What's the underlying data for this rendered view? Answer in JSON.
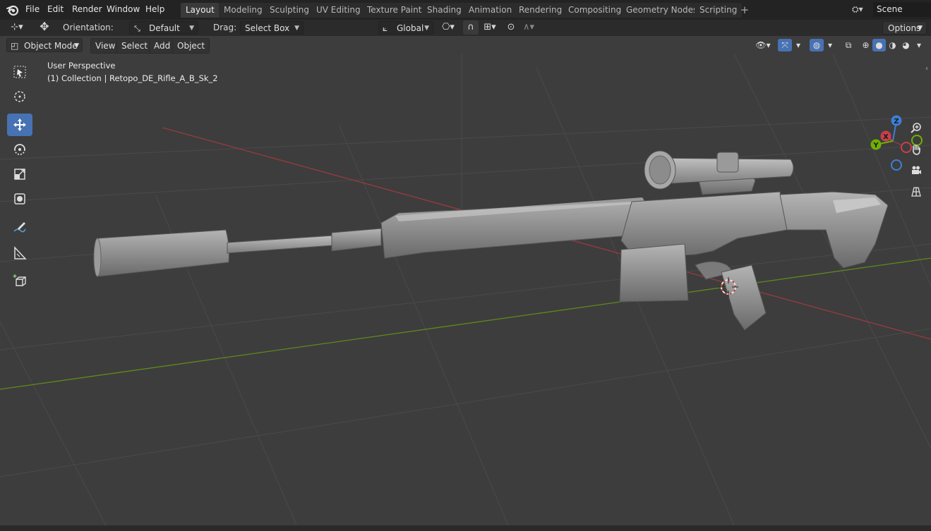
{
  "menu": {
    "logo_icon": "blender-logo-icon",
    "items": [
      "File",
      "Edit",
      "Render",
      "Window",
      "Help"
    ]
  },
  "workspaces": {
    "tabs": [
      "Layout",
      "Modeling",
      "Sculpting",
      "UV Editing",
      "Texture Paint",
      "Shading",
      "Animation",
      "Rendering",
      "Compositing",
      "Geometry Nodes",
      "Scripting"
    ],
    "active": "Layout",
    "add_label": "+"
  },
  "scene": {
    "name": "Scene"
  },
  "tool_settings": {
    "orientation_label": "Orientation:",
    "orientation_value": "Default",
    "drag_label": "Drag:",
    "drag_value": "Select Box",
    "transform_orientation": "Global",
    "options_label": "Options"
  },
  "viewport_header": {
    "mode": "Object Mode",
    "menus": [
      "View",
      "Select",
      "Add",
      "Object"
    ]
  },
  "viewport": {
    "perspective_label": "User Perspective",
    "collection_label": "(1) Collection | Retopo_DE_Rifle_A_B_Sk_2"
  },
  "gizmo": {
    "z": "Z",
    "x": "X",
    "y": "Y"
  },
  "colors": {
    "active_tool": "#4772b3",
    "x_axis": "#c8404a",
    "y_axis": "#70b000",
    "z_axis": "#3d7fd6",
    "background": "#3d3d3d"
  },
  "tools": [
    "select-box-icon",
    "cursor-icon",
    "move-icon",
    "rotate-icon",
    "scale-icon",
    "transform-icon",
    "annotate-icon",
    "measure-icon",
    "add-cube-icon"
  ],
  "active_tool": "move-icon",
  "nav_icons": [
    "zoom-icon",
    "hand-pan-icon",
    "camera-icon",
    "grid-ortho-icon"
  ]
}
